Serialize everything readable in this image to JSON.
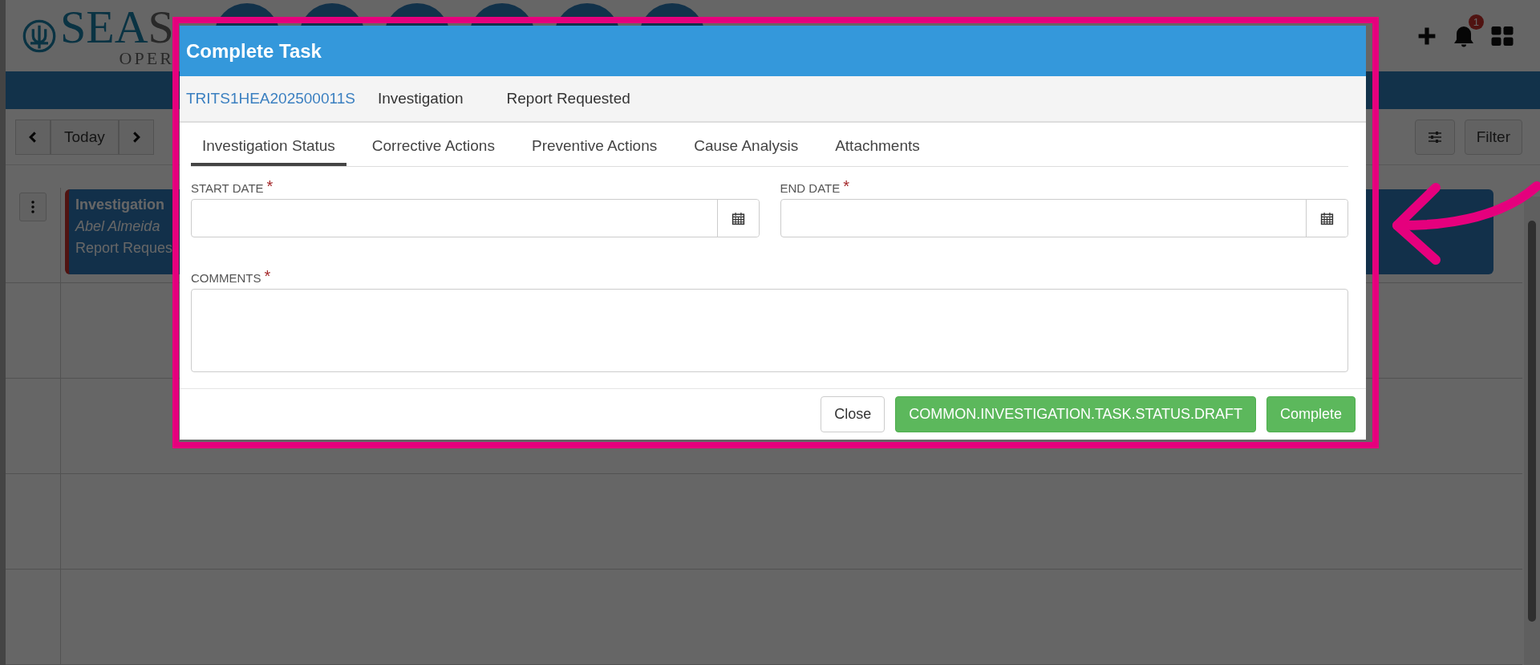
{
  "app": {
    "logo": {
      "part_1": "SEA",
      "part_2": "S",
      "subtitle": "OPER"
    },
    "notifications": {
      "count": "1"
    },
    "toolbar": {
      "today": "Today",
      "filter": "Filter"
    },
    "event": {
      "title": "Investigation",
      "assignee": "Abel Almeida",
      "status": "Report Reques"
    }
  },
  "dialog": {
    "title": "Complete Task",
    "reference": "TRITS1HEA202500011S",
    "type": "Investigation",
    "status": "Report Requested",
    "tabs": [
      {
        "label": "Investigation Status",
        "selected": true
      },
      {
        "label": "Corrective Actions",
        "selected": false
      },
      {
        "label": "Preventive Actions",
        "selected": false
      },
      {
        "label": "Cause Analysis",
        "selected": false
      },
      {
        "label": "Attachments",
        "selected": false
      }
    ],
    "fields": [
      {
        "kind": "date",
        "label": "START DATE",
        "required_mark": "*"
      },
      {
        "kind": "date",
        "label": "END DATE",
        "required_mark": "*"
      },
      {
        "kind": "textarea",
        "label": "COMMENTS",
        "required_mark": "*"
      }
    ],
    "buttons": [
      {
        "label": "Close",
        "kind": "default"
      },
      {
        "label": "COMMON.INVESTIGATION.TASK.STATUS.DRAFT",
        "kind": "success"
      },
      {
        "label": "Complete",
        "kind": "success"
      }
    ]
  }
}
